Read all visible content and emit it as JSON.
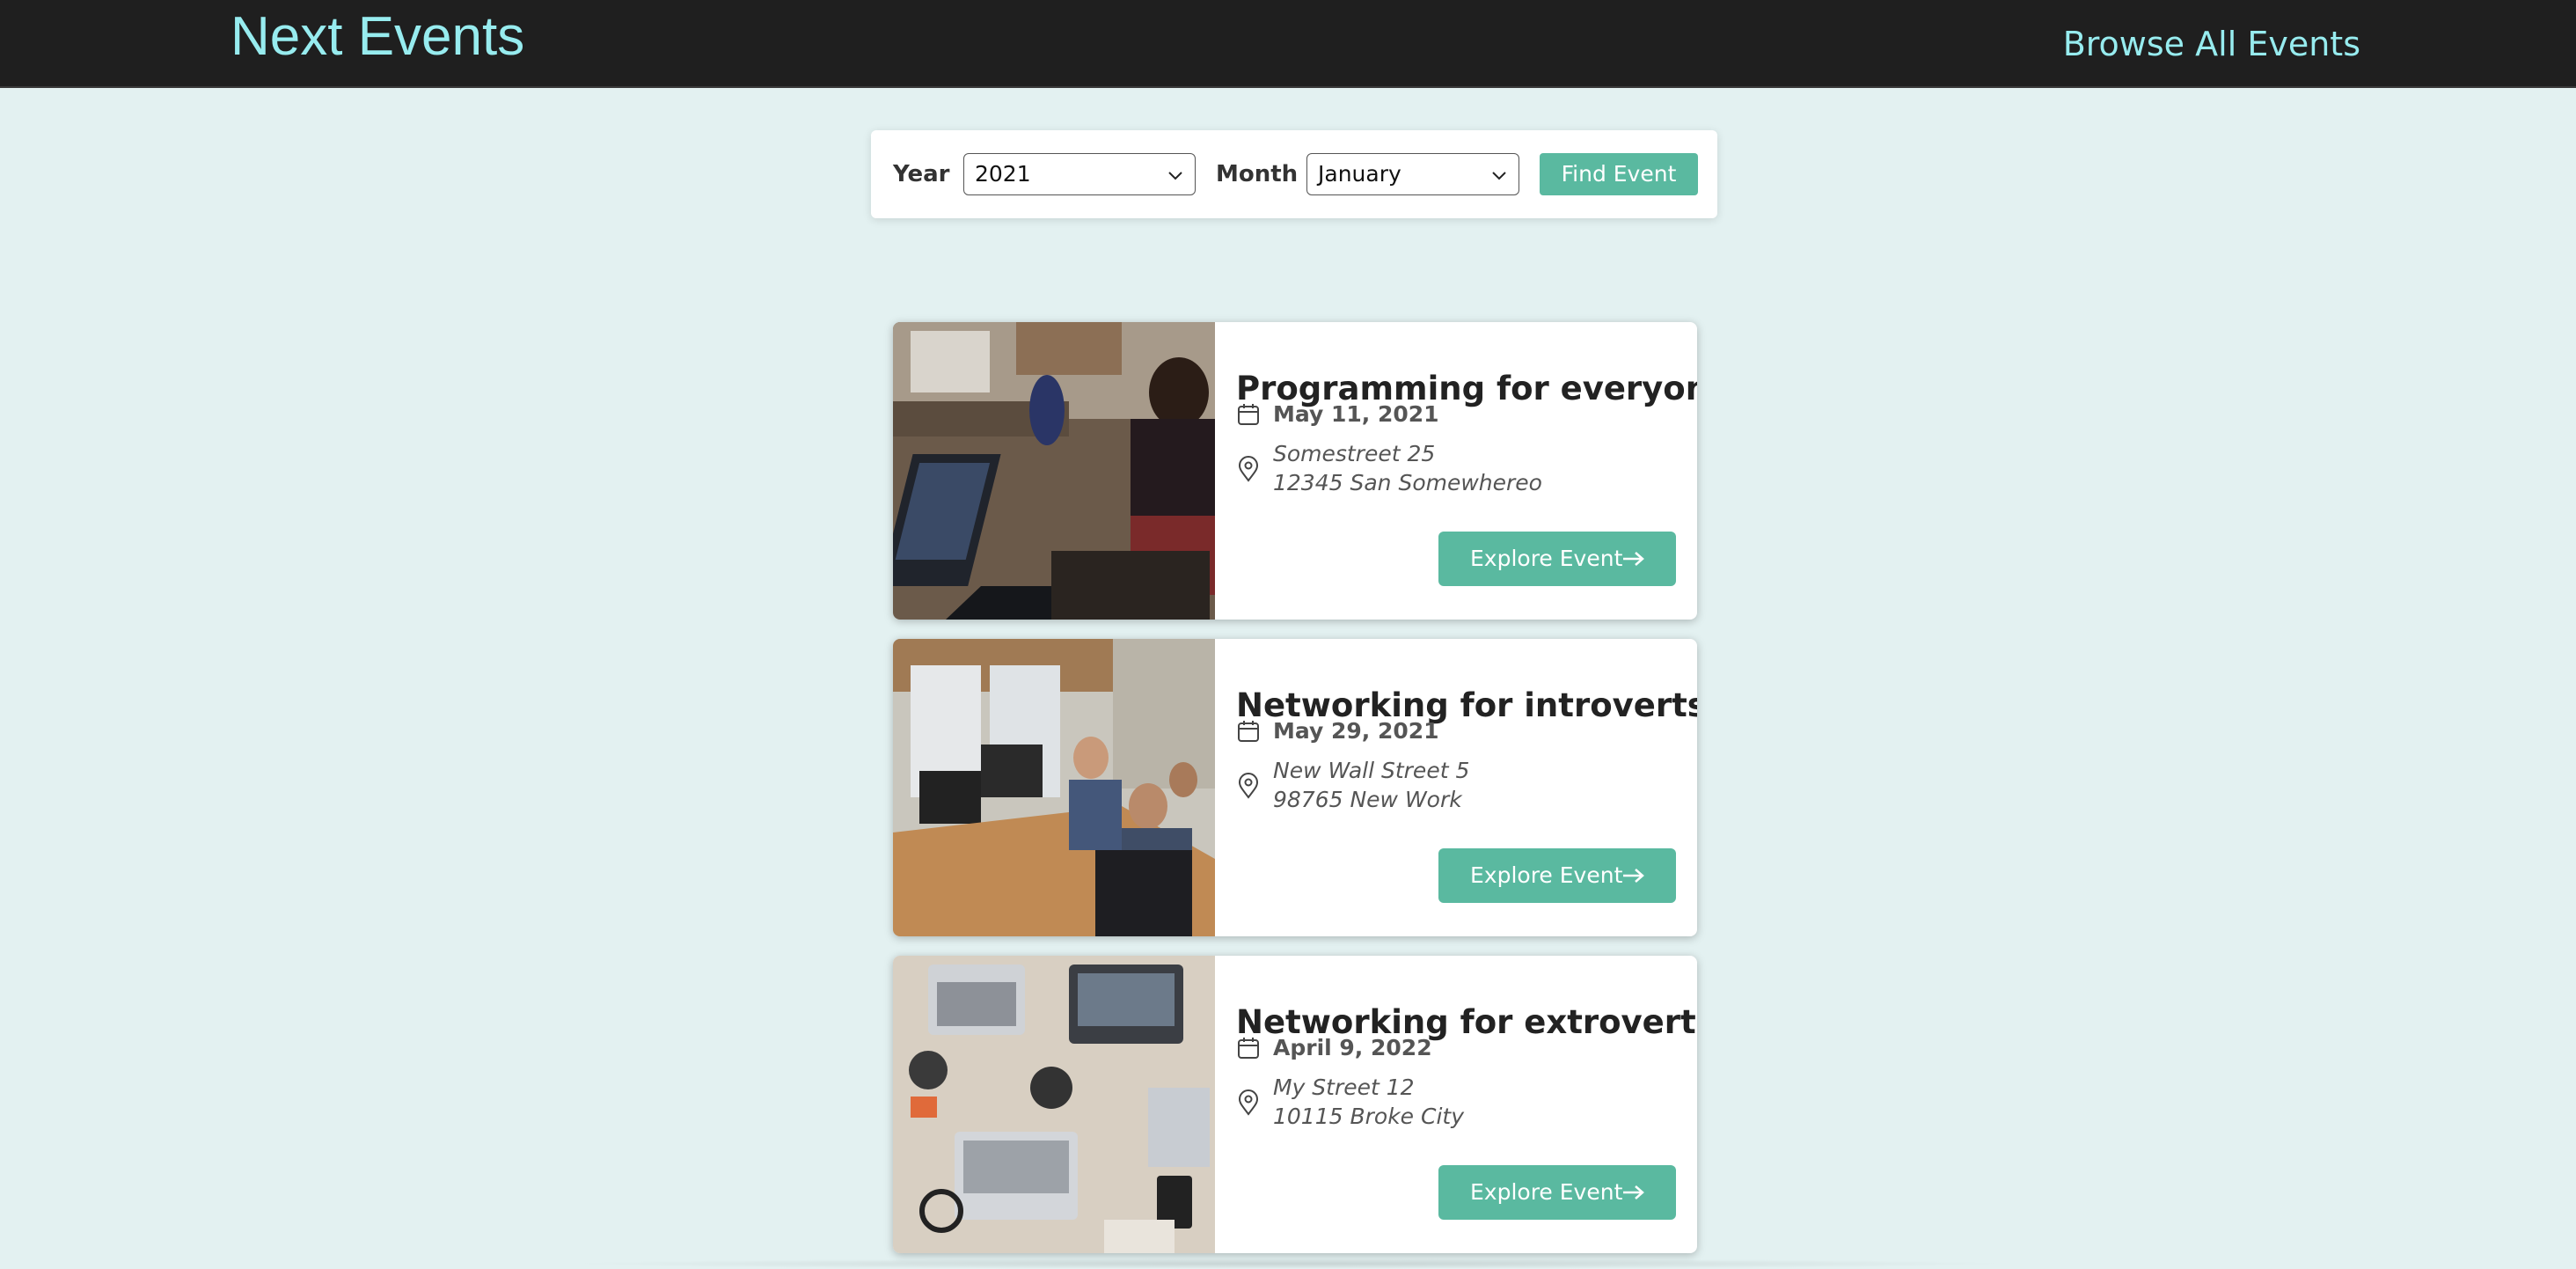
{
  "header": {
    "logo": "Next Events",
    "nav_link": "Browse All Events"
  },
  "filter": {
    "year_label": "Year",
    "year_value": "2021",
    "month_label": "Month",
    "month_value": "January",
    "find_button": "Find Event"
  },
  "events": [
    {
      "title": "Programming for everyone",
      "date": "May 11, 2021",
      "address_line1": "Somestreet 25",
      "address_line2": "12345 San Somewhereo",
      "button": "Explore Event"
    },
    {
      "title": "Networking for introverts",
      "date": "May 29, 2021",
      "address_line1": "New Wall Street 5",
      "address_line2": "98765 New Work",
      "button": "Explore Event"
    },
    {
      "title": "Networking for extroverts",
      "date": "April 9, 2022",
      "address_line1": "My Street 12",
      "address_line2": "10115 Broke City",
      "button": "Explore Event"
    }
  ],
  "icons": {
    "date": "calendar-icon",
    "location": "location-pin-icon",
    "arrow": "arrow-right-icon",
    "select": "chevron-down-icon"
  },
  "colors": {
    "header_bg": "#1f1f1f",
    "accent_text": "#97ecef",
    "page_bg": "#e3f1f1",
    "button": "#5ab9a0"
  }
}
